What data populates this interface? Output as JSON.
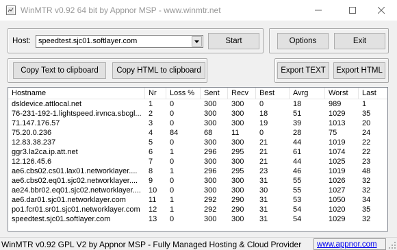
{
  "window": {
    "title": "WinMTR v0.92 64 bit by Appnor MSP - www.winmtr.net"
  },
  "host": {
    "label": "Host:",
    "value": "speedtest.sjc01.softlayer.com"
  },
  "buttons": {
    "start": "Start",
    "options": "Options",
    "exit": "Exit",
    "copy_text": "Copy Text to clipboard",
    "copy_html": "Copy HTML to clipboard",
    "export_text": "Export TEXT",
    "export_html": "Export HTML"
  },
  "table": {
    "columns": [
      "Hostname",
      "Nr",
      "Loss %",
      "Sent",
      "Recv",
      "Best",
      "Avrg",
      "Worst",
      "Last"
    ],
    "rows": [
      [
        "dsldevice.attlocal.net",
        "1",
        "0",
        "300",
        "300",
        "0",
        "18",
        "989",
        "1"
      ],
      [
        "76-231-192-1.lightspeed.irvnca.sbcgl...",
        "2",
        "0",
        "300",
        "300",
        "18",
        "51",
        "1029",
        "35"
      ],
      [
        "71.147.176.57",
        "3",
        "0",
        "300",
        "300",
        "19",
        "39",
        "1013",
        "20"
      ],
      [
        "75.20.0.236",
        "4",
        "84",
        "68",
        "11",
        "0",
        "28",
        "75",
        "24"
      ],
      [
        "12.83.38.237",
        "5",
        "0",
        "300",
        "300",
        "21",
        "44",
        "1019",
        "22"
      ],
      [
        "ggr3.la2ca.ip.att.net",
        "6",
        "1",
        "296",
        "295",
        "21",
        "61",
        "1074",
        "22"
      ],
      [
        "12.126.45.6",
        "7",
        "0",
        "300",
        "300",
        "21",
        "44",
        "1025",
        "23"
      ],
      [
        "ae6.cbs02.cs01.lax01.networklayer....",
        "8",
        "1",
        "296",
        "295",
        "23",
        "46",
        "1019",
        "48"
      ],
      [
        "ae6.cbs02.eq01.sjc02.networklayer....",
        "9",
        "0",
        "300",
        "300",
        "31",
        "55",
        "1026",
        "32"
      ],
      [
        "ae24.bbr02.eq01.sjc02.networklayer....",
        "10",
        "0",
        "300",
        "300",
        "30",
        "55",
        "1027",
        "32"
      ],
      [
        "ae6.dar01.sjc01.networklayer.com",
        "11",
        "1",
        "292",
        "290",
        "31",
        "53",
        "1050",
        "34"
      ],
      [
        "po1.fcr01.sr01.sjc01.networklayer.com",
        "12",
        "1",
        "292",
        "290",
        "31",
        "54",
        "1020",
        "35"
      ],
      [
        "speedtest.sjc01.softlayer.com",
        "13",
        "0",
        "300",
        "300",
        "31",
        "54",
        "1029",
        "32"
      ]
    ]
  },
  "statusbar": {
    "text": "WinMTR v0.92 GPL V2 by Appnor MSP - Fully Managed Hosting & Cloud Provider",
    "link": "www.appnor.com"
  },
  "colors": {
    "link": "#0000ee",
    "window_bg": "#f0f0f0",
    "title_text": "#999999"
  }
}
